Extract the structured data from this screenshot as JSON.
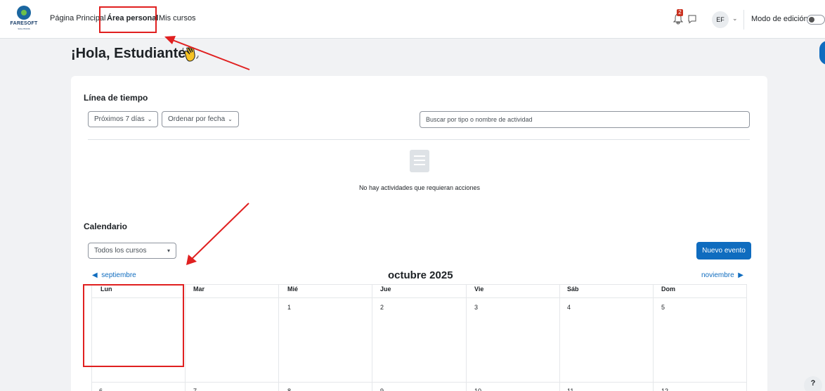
{
  "brand": {
    "logo_name": "FARESOFT",
    "logo_sub": "SOLUTIONS"
  },
  "nav": {
    "home": "Página Principal",
    "dashboard": "Área personal",
    "my_courses": "Mis cursos",
    "notifications_count": "2",
    "user_initials": "EF",
    "edit_mode_label": "Modo de edición"
  },
  "greeting": "¡Hola, Estudiante!",
  "timeline": {
    "title": "Línea de tiempo",
    "filter_days": "Próximos 7 días",
    "sort": "Ordenar por fecha",
    "search_placeholder": "Buscar por tipo o nombre de actividad",
    "empty_message": "No hay actividades que requieran acciones"
  },
  "calendar": {
    "title": "Calendario",
    "course_filter": "Todos los cursos",
    "new_event": "Nuevo evento",
    "prev_month": "septiembre",
    "next_month": "noviembre",
    "current_month": "octubre 2025",
    "weekdays": [
      "Lun",
      "Mar",
      "Mié",
      "Jue",
      "Vie",
      "Sáb",
      "Dom"
    ],
    "week1": [
      "",
      "",
      "1",
      "2",
      "3",
      "4",
      "5"
    ],
    "week2": [
      "6",
      "7",
      "8",
      "9",
      "10",
      "11",
      "12"
    ]
  },
  "help_label": "?",
  "colors": {
    "primary": "#0f6cbf",
    "annotation": "#e02020",
    "badge": "#ca3120"
  }
}
